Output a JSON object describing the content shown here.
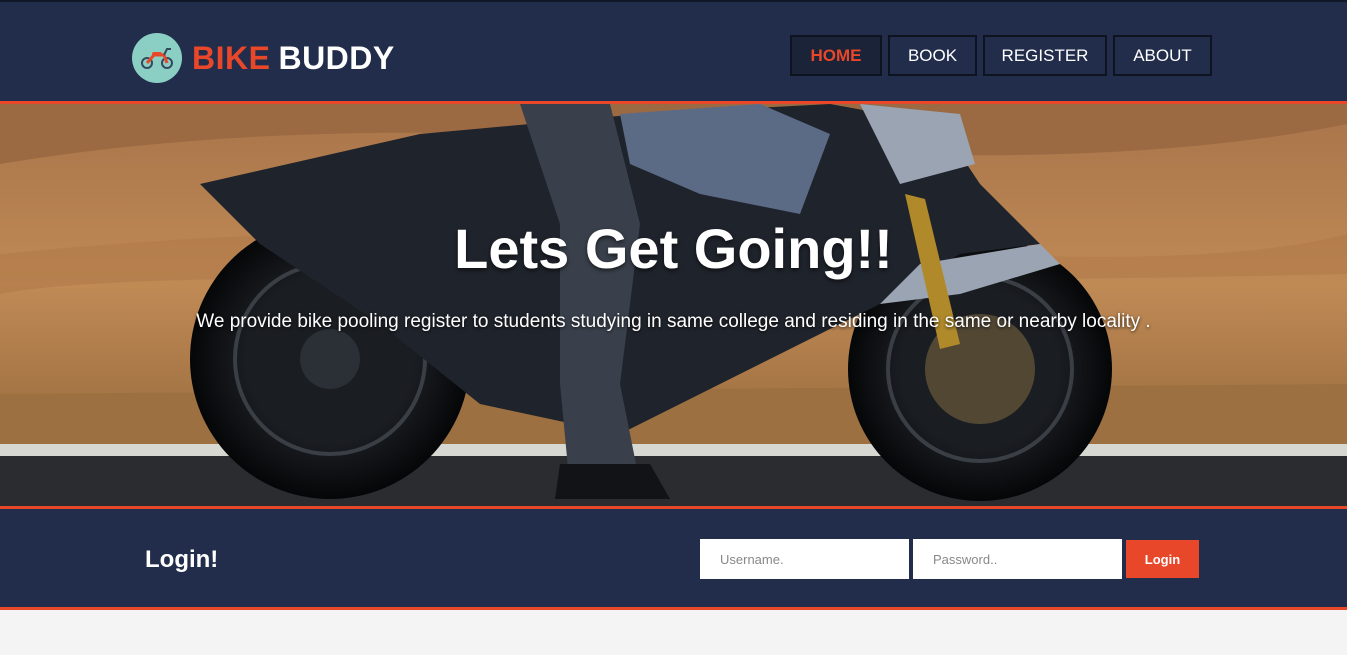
{
  "brand": {
    "part1": "BIKE",
    "part2": "BUDDY",
    "logo_icon": "scooter-icon"
  },
  "nav": {
    "items": [
      {
        "label": "HOME",
        "active": true
      },
      {
        "label": "BOOK",
        "active": false
      },
      {
        "label": "REGISTER",
        "active": false
      },
      {
        "label": "ABOUT",
        "active": false
      }
    ]
  },
  "hero": {
    "title": "Lets Get Going!!",
    "subtitle": "We provide bike pooling register to students studying in same college and residing in the same or nearby locality ."
  },
  "login": {
    "title": "Login!",
    "username_placeholder": "Username.",
    "password_placeholder": "Password..",
    "button_label": "Login"
  },
  "colors": {
    "accent": "#e8472a",
    "navy": "#212d4a",
    "logo_bg": "#8bcfc4"
  }
}
